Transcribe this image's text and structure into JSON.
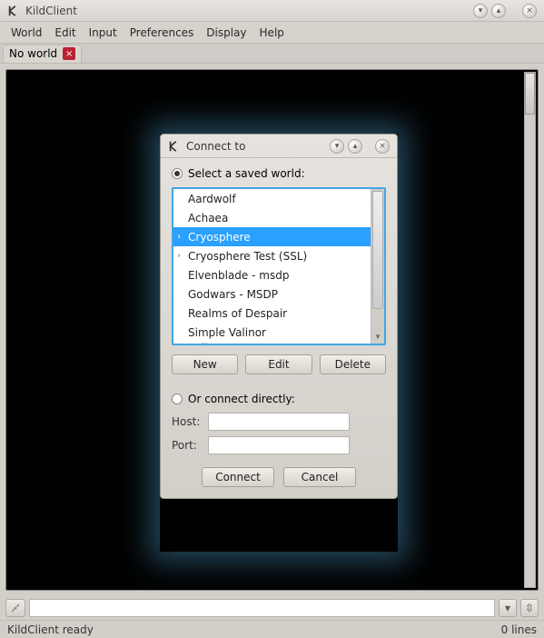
{
  "window": {
    "title": "KildClient"
  },
  "menu": {
    "items": [
      "World",
      "Edit",
      "Input",
      "Preferences",
      "Display",
      "Help"
    ]
  },
  "tab": {
    "label": "No world"
  },
  "status": {
    "left": "KildClient ready",
    "right": "0 lines"
  },
  "dialog": {
    "title": "Connect to",
    "radio_saved": "Select a saved world:",
    "radio_direct": "Or connect directly:",
    "buttons": {
      "new": "New",
      "edit": "Edit",
      "delete": "Delete",
      "connect": "Connect",
      "cancel": "Cancel"
    },
    "host_label": "Host:",
    "port_label": "Port:",
    "host_value": "",
    "port_value": "",
    "worlds": [
      {
        "name": "Aardwolf",
        "selected": false,
        "haschild": false
      },
      {
        "name": "Achaea",
        "selected": false,
        "haschild": false
      },
      {
        "name": "Cryosphere",
        "selected": true,
        "haschild": true
      },
      {
        "name": "Cryosphere Test (SSL)",
        "selected": false,
        "haschild": true
      },
      {
        "name": "Elvenblade - msdp",
        "selected": false,
        "haschild": false
      },
      {
        "name": "Godwars - MSDP",
        "selected": false,
        "haschild": false
      },
      {
        "name": "Realms of Despair",
        "selected": false,
        "haschild": false
      },
      {
        "name": "Simple Valinor",
        "selected": false,
        "haschild": false
      },
      {
        "name": "Valinor",
        "selected": false,
        "haschild": true
      }
    ]
  }
}
